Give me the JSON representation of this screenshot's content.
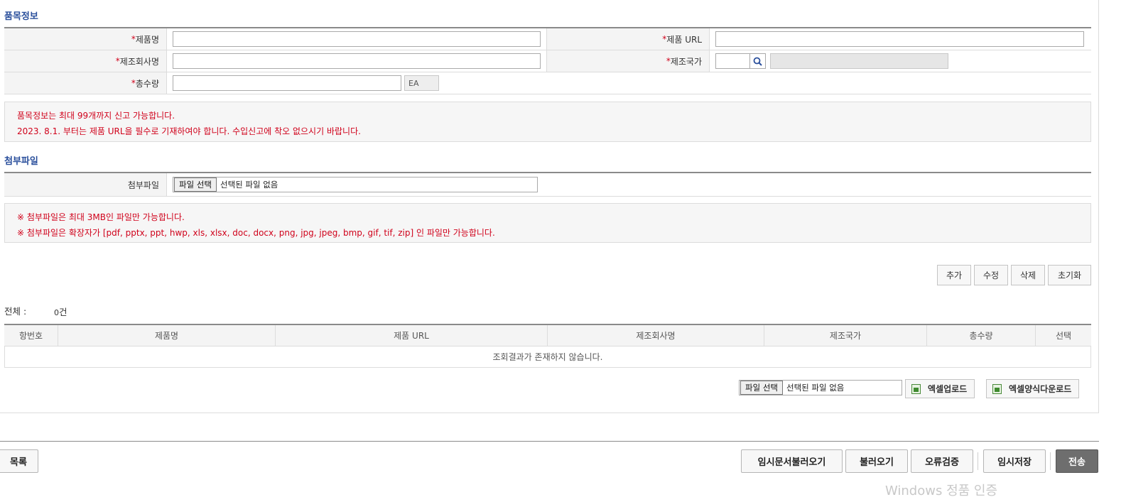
{
  "product_section": {
    "title": "품목정보",
    "required_mark": "*",
    "fields": {
      "product_name_label": "제품명",
      "product_url_label": "제품 URL",
      "manufacturer_label": "제조회사명",
      "country_label": "제조국가",
      "quantity_label": "총수량",
      "quantity_unit": "EA"
    }
  },
  "product_notice": [
    "품목정보는 최대 99개까지 신고 가능합니다.",
    "2023. 8.1. 부터는 제품 URL을 필수로 기재하여야 합니다. 수입신고에 착오 없으시기 바랍니다."
  ],
  "attachment_section": {
    "title": "첨부파일",
    "label": "첨부파일",
    "file_button": "파일 선택",
    "file_status": "선택된 파일 없음"
  },
  "attachment_notice": [
    "※ 첨부파일은 최대 3MB인 파일만 가능합니다.",
    "※ 첨부파일은 확장자가 [pdf, pptx, ppt, hwp, xls, xlsx, doc, docx, png, jpg, jpeg, bmp, gif, tif, zip] 인 파일만 가능합니다."
  ],
  "row_actions": {
    "add": "추가",
    "edit": "수정",
    "delete": "삭제",
    "reset": "초기화"
  },
  "summary": {
    "total_label": "전체 :",
    "count": "0",
    "count_unit": "건"
  },
  "grid": {
    "columns": [
      "항번호",
      "제품명",
      "제품 URL",
      "제조회사명",
      "제조국가",
      "총수량",
      "선택"
    ],
    "empty_message": "조회결과가 존재하지 않습니다."
  },
  "excel": {
    "file_button": "파일 선택",
    "file_status": "선택된 파일 없음",
    "upload": "엑셀업로드",
    "template_download": "엑셀양식다운로드"
  },
  "footer": {
    "list": "목록",
    "load_temp": "임시문서불러오기",
    "load": "불러오기",
    "validate": "오류검증",
    "save_temp": "임시저장",
    "submit": "전송"
  },
  "watermark": "Windows 정품 인증"
}
